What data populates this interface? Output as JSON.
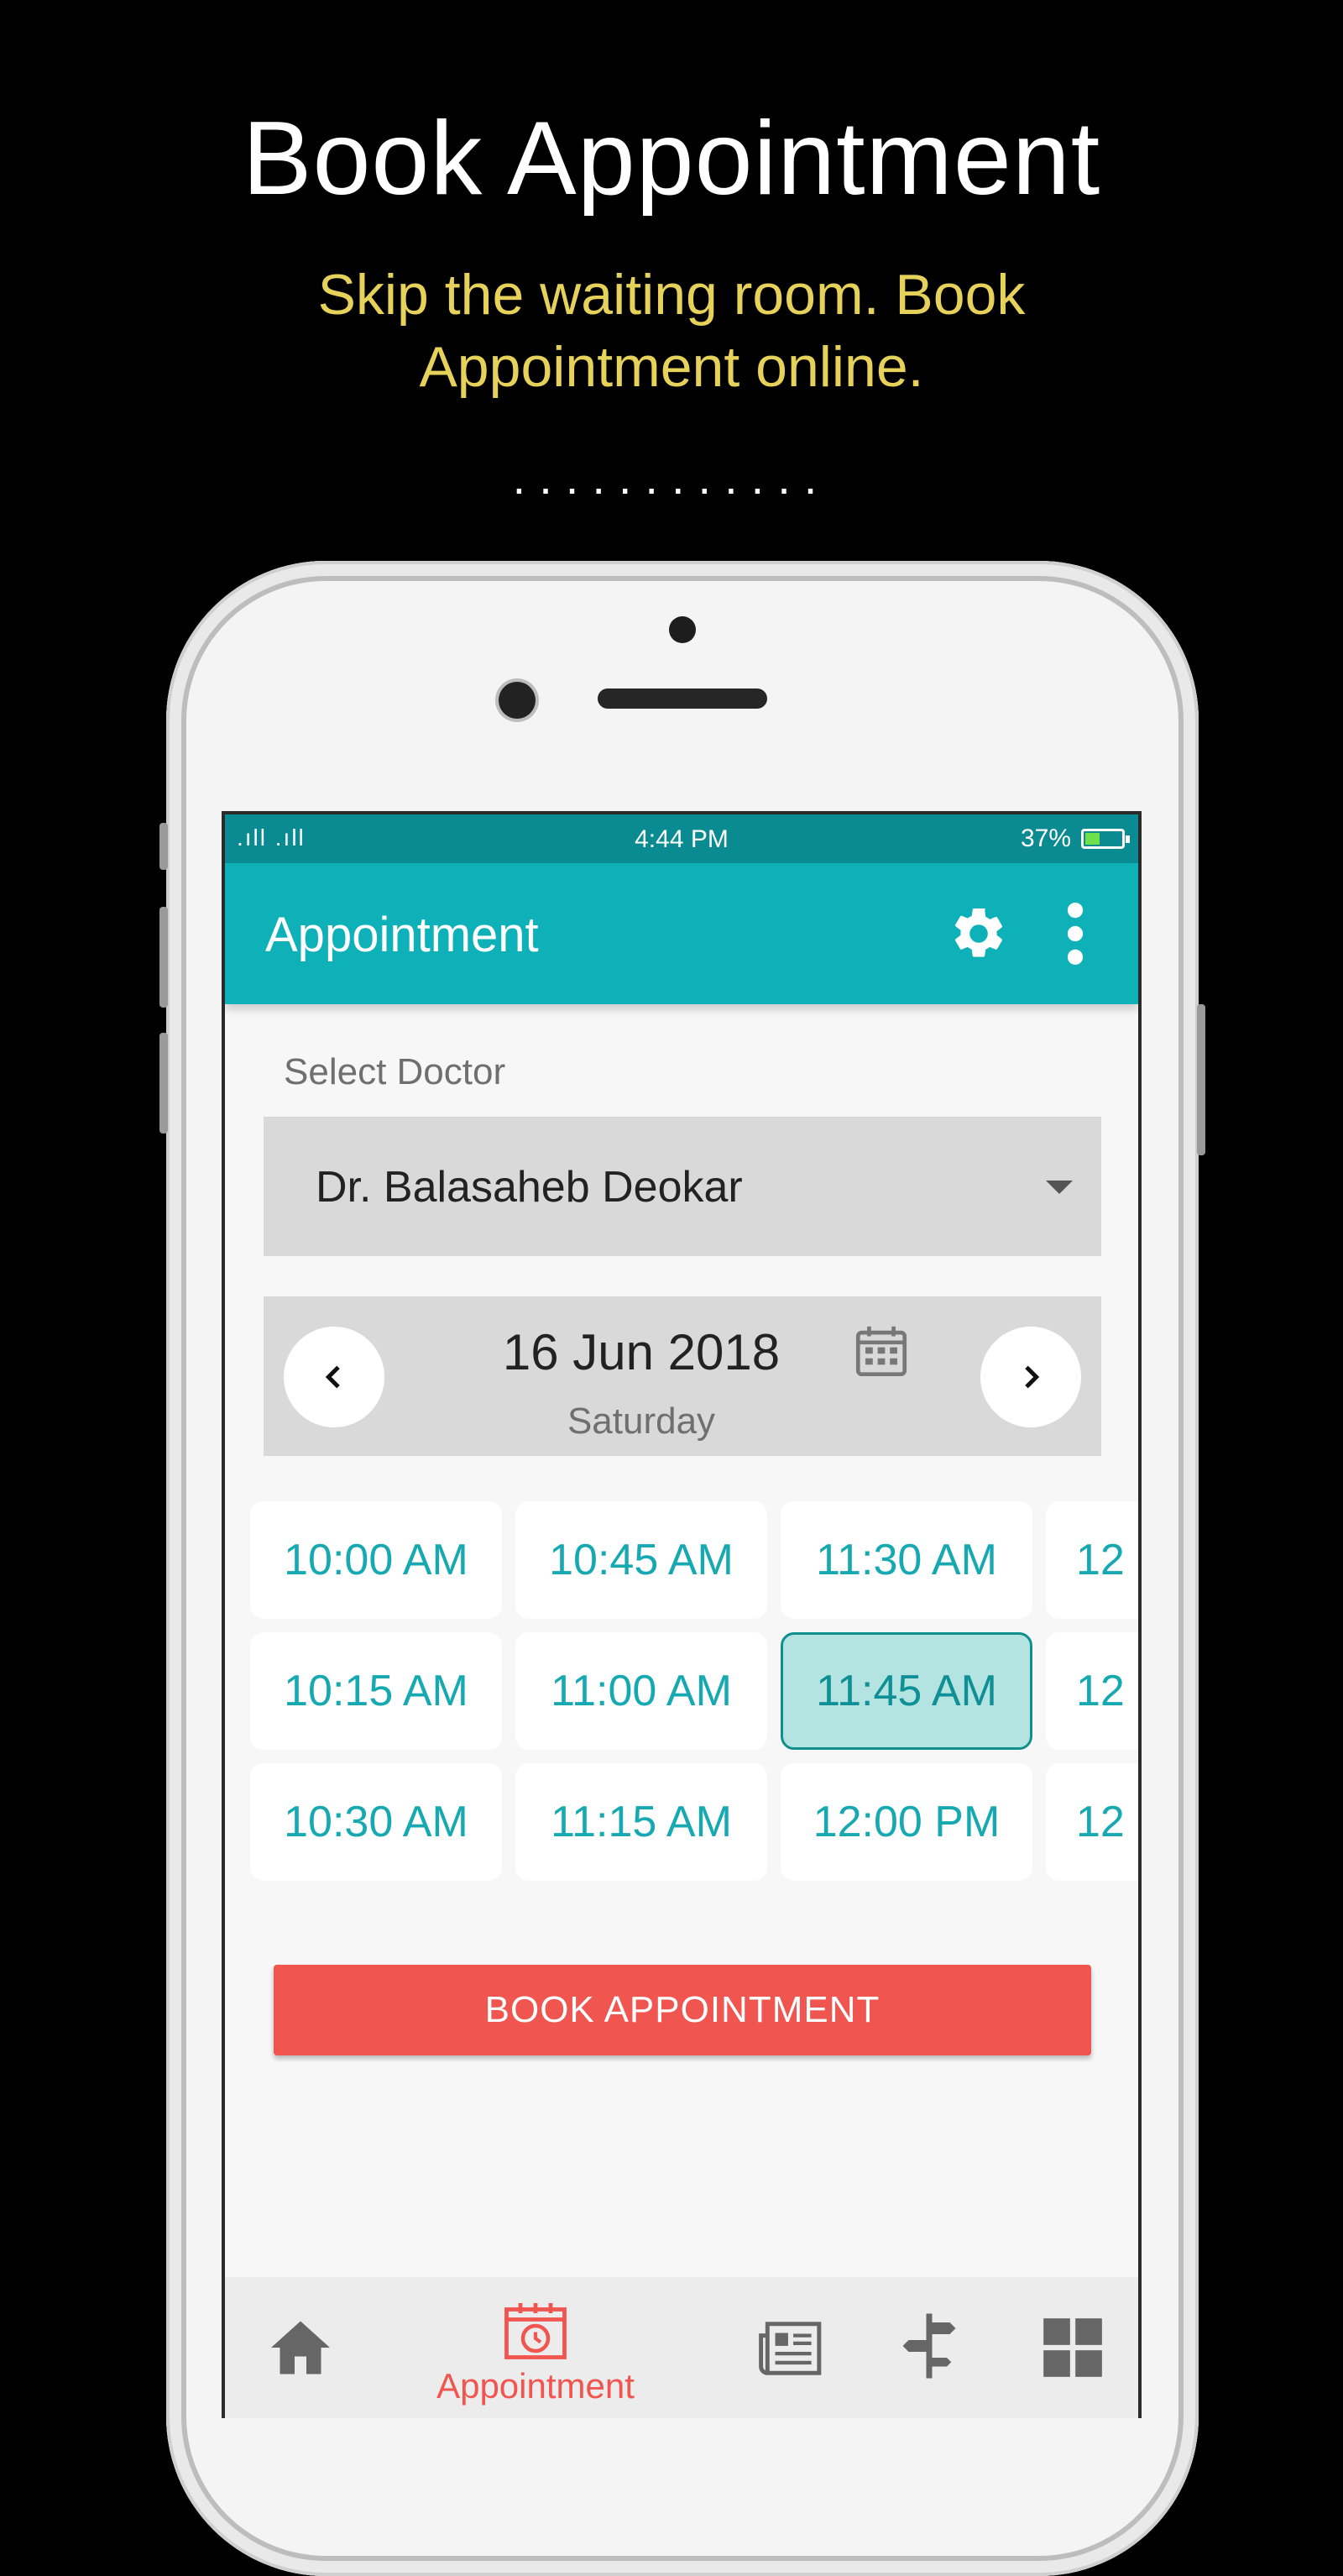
{
  "promo": {
    "title": "Book Appointment",
    "subtitle_line1": "Skip the waiting room. Book",
    "subtitle_line2": "Appointment online.",
    "dots": "............"
  },
  "statusbar": {
    "signal": ".ıll .ıll",
    "time": "4:44 PM",
    "battery": "37%",
    "battery_level": 0.37
  },
  "appbar": {
    "title": "Appointment",
    "settings_icon": "gear-icon",
    "menu_icon": "more-vert-icon"
  },
  "doctor": {
    "label": "Select Doctor",
    "selected": "Dr. Balasaheb Deokar"
  },
  "date": {
    "date": "16 Jun 2018",
    "day": "Saturday"
  },
  "slots": {
    "row1": [
      "10:00 AM",
      "10:45 AM",
      "11:30 AM",
      "12"
    ],
    "row2": [
      "10:15 AM",
      "11:00 AM",
      "11:45 AM",
      "12"
    ],
    "row3": [
      "10:30 AM",
      "11:15 AM",
      "12:00 PM",
      "12"
    ],
    "selected": "11:45 AM"
  },
  "book_button": "BOOK APPOINTMENT",
  "bottom_nav": {
    "items": [
      "home-icon",
      "appointment-icon",
      "news-icon",
      "directions-icon",
      "grid-icon"
    ],
    "active_label": "Appointment"
  },
  "colors": {
    "primary": "#0fb1b9",
    "status": "#0a8b92",
    "accent": "#f15550",
    "slot_text": "#16a9b1",
    "promo_sub": "#e6d25a"
  }
}
